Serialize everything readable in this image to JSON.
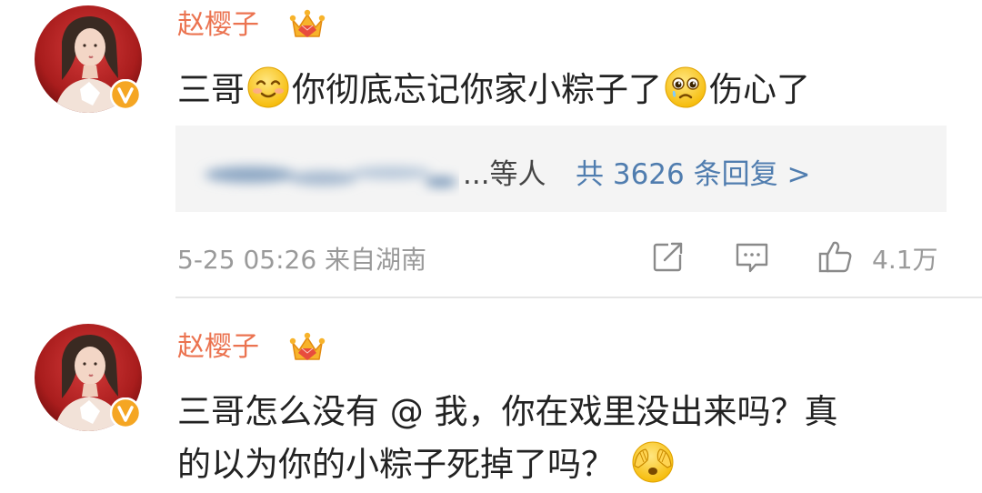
{
  "colors": {
    "username": "#eb7350",
    "text": "#222222",
    "link": "#507daf",
    "meta": "#9a9a9a",
    "reply_bg": "#f4f4f4",
    "badge": "#f5a623"
  },
  "comments": [
    {
      "username": "赵樱子",
      "avatar_icon": "user-avatar-photo",
      "badge_icon": "verified-v-icon",
      "crown_icon": "crown-member-icon",
      "text_parts": [
        "三哥",
        "你彻底忘记你家小粽子了",
        "伤心了"
      ],
      "emojis": [
        "smile-emoji",
        "sad-teary-emoji"
      ],
      "reply_preview": {
        "others": "...等人",
        "total": "共 3626 条回复 >"
      },
      "time_source": "5-25 05:26 来自湖南",
      "likes": "4.1万",
      "action_icons": [
        "share-icon",
        "comment-icon",
        "like-icon"
      ]
    },
    {
      "username": "赵樱子",
      "avatar_icon": "user-avatar-photo",
      "badge_icon": "verified-v-icon",
      "crown_icon": "crown-member-icon",
      "text_lines": [
        "三哥怎么没有 @ 我，你在戏里没出来吗？真",
        "的以为你的小粽子死掉了吗？"
      ],
      "emojis": [
        "cover-face-emoji"
      ]
    }
  ]
}
